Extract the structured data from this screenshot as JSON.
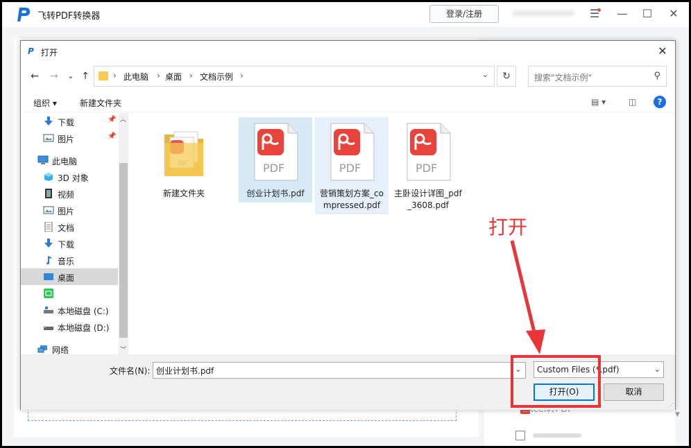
{
  "app": {
    "title": "飞转PDF转换器",
    "login_label": "登录/注册",
    "menu_icon": "menu-icon",
    "right_item_label": "Excel转PDF"
  },
  "dialog": {
    "title": "打开",
    "close_label": "✕"
  },
  "nav": {
    "back": "←",
    "forward": "→",
    "recent": "⌄",
    "up": "↑"
  },
  "address": {
    "crumbs": [
      "此电脑",
      "桌面",
      "文档示例"
    ],
    "refresh": "↻"
  },
  "search": {
    "placeholder": "搜索\"文档示例\""
  },
  "toolbar": {
    "organize": "组织 ▾",
    "new_folder": "新建文件夹",
    "help": "?"
  },
  "sidebar": {
    "items": [
      {
        "label": "下载",
        "icon": "download-icon",
        "pinned": true
      },
      {
        "label": "图片",
        "icon": "pictures-icon",
        "pinned": true
      },
      {
        "label": "此电脑",
        "icon": "computer-icon"
      },
      {
        "label": "3D 对象",
        "icon": "3d-objects-icon"
      },
      {
        "label": "视频",
        "icon": "video-icon"
      },
      {
        "label": "图片",
        "icon": "pictures-icon"
      },
      {
        "label": "文档",
        "icon": "documents-icon"
      },
      {
        "label": "下载",
        "icon": "download-icon"
      },
      {
        "label": "音乐",
        "icon": "music-icon"
      },
      {
        "label": "桌面",
        "icon": "desktop-icon",
        "selected": true
      },
      {
        "label": "",
        "icon": "app-icon"
      },
      {
        "label": "本地磁盘 (C:)",
        "icon": "drive-c-icon"
      },
      {
        "label": "本地磁盘 (D:)",
        "icon": "drive-d-icon"
      },
      {
        "label": "网络",
        "icon": "network-icon"
      }
    ]
  },
  "files": [
    {
      "name": "新建文件夹",
      "type": "folder"
    },
    {
      "name": "创业计划书.pdf",
      "type": "pdf",
      "selected": true
    },
    {
      "name": "营销策划方案_compressed.pdf",
      "type": "pdf",
      "hover": true
    },
    {
      "name": "主卧设计详图_pdf_3608.pdf",
      "type": "pdf"
    }
  ],
  "bottom": {
    "filename_label": "文件名(N):",
    "filename_value": "创业计划书.pdf",
    "file_type": "Custom Files (*.pdf)",
    "open_label": "打开(O)",
    "cancel_label": "取消"
  },
  "annotation": {
    "text": "打开",
    "color": "#e8353a"
  },
  "colors": {
    "accent": "#0078d7",
    "pdf_red": "#e8443b",
    "selection": "#d9eaf7",
    "folder": "#f6cc57"
  }
}
